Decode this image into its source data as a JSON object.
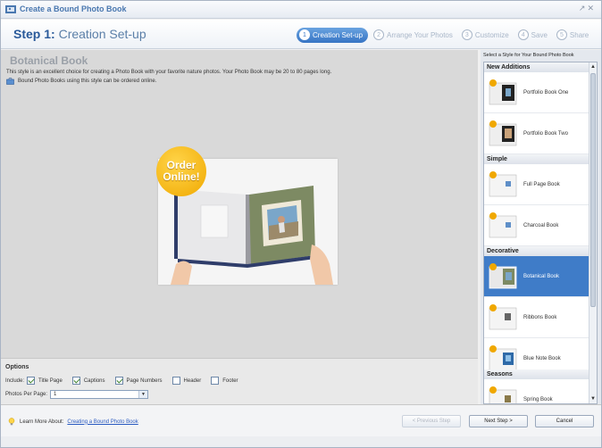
{
  "window": {
    "title": "Create a Bound Photo Book",
    "controls": "ᵛ X"
  },
  "step_header": {
    "step_num": "Step 1:",
    "step_name": "Creation Set-up"
  },
  "steps": [
    {
      "num": "1",
      "label": "Creation Set-up"
    },
    {
      "num": "2",
      "label": "Arrange Your Photos"
    },
    {
      "num": "3",
      "label": "Customize"
    },
    {
      "num": "4",
      "label": "Save"
    },
    {
      "num": "5",
      "label": "Share"
    }
  ],
  "main": {
    "heading": "Botanical Book",
    "description": "This style is an excellent choice for creating a Photo Book with your favorite nature photos. Your Photo Book may be 20 to 80 pages long.",
    "note": "Bound Photo Books using this style can be ordered online.",
    "badge_line1": "Order",
    "badge_line2": "Online!"
  },
  "options": {
    "label": "Options",
    "include_label": "Include:",
    "checkboxes": [
      {
        "label": "Title Page",
        "checked": true
      },
      {
        "label": "Captions",
        "checked": true
      },
      {
        "label": "Page Numbers",
        "checked": true
      },
      {
        "label": "Header",
        "checked": false
      },
      {
        "label": "Footer",
        "checked": false
      }
    ],
    "photos_per_page_label": "Photos Per Page:",
    "photos_per_page_value": "1"
  },
  "sidebar": {
    "header": "Select a Style for Your Bound Photo Book",
    "categories": [
      "New Additions",
      "Simple",
      "Decorative",
      "Seasons"
    ],
    "items": [
      {
        "label": "Portfolio Book One"
      },
      {
        "label": "Portfolio Book Two"
      },
      {
        "label": "Full Page Book"
      },
      {
        "label": "Charcoal Book"
      },
      {
        "label": "Botanical Book"
      },
      {
        "label": "Ribbons Book"
      },
      {
        "label": "Blue Note Book"
      },
      {
        "label": "Spring Book"
      }
    ],
    "selected_item": "Botanical Book"
  },
  "footer": {
    "learn_more": "Learn More About:",
    "learn_link": "Creating a Bound Photo Book",
    "prev_button": "< Previous Step",
    "next_button": "Next Step >",
    "cancel_button": "Cancel"
  },
  "colors": {
    "accent": "#3f7cc8",
    "badge": "#f0a800",
    "step_active": "#3674c4"
  }
}
